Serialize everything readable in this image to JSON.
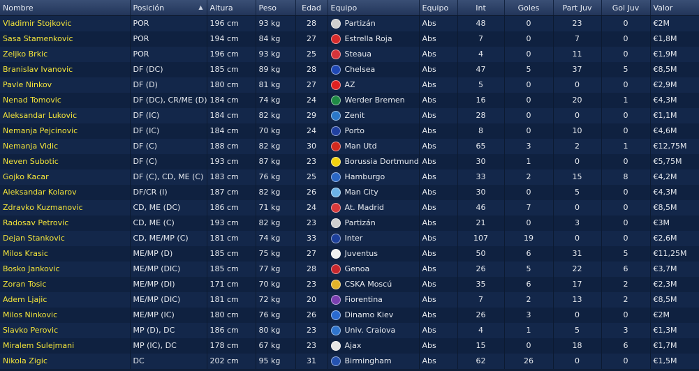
{
  "columns": {
    "nombre": "Nombre",
    "posicion": "Posición",
    "altura": "Altura",
    "peso": "Peso",
    "edad": "Edad",
    "equipo": "Equipo",
    "equipo2": "Equipo",
    "int": "Int",
    "goles": "Goles",
    "partjuv": "Part Juv",
    "goljuv": "Gol Juv",
    "valor": "Valor"
  },
  "sort_indicator": "▲",
  "players": [
    {
      "name": "Vladimir Stojkovic",
      "pos": "POR",
      "height": "196 cm",
      "weight": "93 kg",
      "age": "28",
      "club": "Partizán",
      "crest_color": "#cfcfcf",
      "squad": "Abs",
      "caps": "48",
      "goals": "0",
      "yth_apps": "23",
      "yth_goals": "0",
      "value": "€2M"
    },
    {
      "name": "Sasa Stamenkovic",
      "pos": "POR",
      "height": "194 cm",
      "weight": "84 kg",
      "age": "27",
      "club": "Estrella Roja",
      "crest_color": "#d62b2b",
      "squad": "Abs",
      "caps": "7",
      "goals": "0",
      "yth_apps": "7",
      "yth_goals": "0",
      "value": "€1,8M"
    },
    {
      "name": "Zeljko Brkic",
      "pos": "POR",
      "height": "196 cm",
      "weight": "93 kg",
      "age": "25",
      "club": "Steaua",
      "crest_color": "#d6343a",
      "squad": "Abs",
      "caps": "4",
      "goals": "0",
      "yth_apps": "11",
      "yth_goals": "0",
      "value": "€1,9M"
    },
    {
      "name": "Branislav Ivanovic",
      "pos": "DF (DC)",
      "height": "185 cm",
      "weight": "89 kg",
      "age": "28",
      "club": "Chelsea",
      "crest_color": "#1f48b5",
      "squad": "Abs",
      "caps": "47",
      "goals": "5",
      "yth_apps": "37",
      "yth_goals": "5",
      "value": "€8,5M"
    },
    {
      "name": "Pavle Ninkov",
      "pos": "DF (D)",
      "height": "180 cm",
      "weight": "81 kg",
      "age": "27",
      "club": "AZ",
      "crest_color": "#e02020",
      "squad": "Abs",
      "caps": "5",
      "goals": "0",
      "yth_apps": "0",
      "yth_goals": "0",
      "value": "€2,9M"
    },
    {
      "name": "Nenad Tomovic",
      "pos": "DF (DC), CR/ME (D)",
      "height": "184 cm",
      "weight": "74 kg",
      "age": "24",
      "club": "Werder Bremen",
      "crest_color": "#1f8a45",
      "squad": "Abs",
      "caps": "16",
      "goals": "0",
      "yth_apps": "20",
      "yth_goals": "1",
      "value": "€4,3M"
    },
    {
      "name": "Aleksandar Lukovic",
      "pos": "DF (IC)",
      "height": "184 cm",
      "weight": "82 kg",
      "age": "29",
      "club": "Zenit",
      "crest_color": "#2b78c9",
      "squad": "Abs",
      "caps": "28",
      "goals": "0",
      "yth_apps": "0",
      "yth_goals": "0",
      "value": "€1,1M"
    },
    {
      "name": "Nemanja Pejcinovic",
      "pos": "DF (IC)",
      "height": "184 cm",
      "weight": "70 kg",
      "age": "24",
      "club": "Porto",
      "crest_color": "#2040a0",
      "squad": "Abs",
      "caps": "8",
      "goals": "0",
      "yth_apps": "10",
      "yth_goals": "0",
      "value": "€4,6M"
    },
    {
      "name": "Nemanja Vidic",
      "pos": "DF (C)",
      "height": "188 cm",
      "weight": "82 kg",
      "age": "30",
      "club": "Man Utd",
      "crest_color": "#d42a1f",
      "squad": "Abs",
      "caps": "65",
      "goals": "3",
      "yth_apps": "2",
      "yth_goals": "1",
      "value": "€12,75M"
    },
    {
      "name": "Neven Subotic",
      "pos": "DF (C)",
      "height": "193 cm",
      "weight": "87 kg",
      "age": "23",
      "club": "Borussia Dortmund",
      "crest_color": "#f2d20f",
      "squad": "Abs",
      "caps": "30",
      "goals": "1",
      "yth_apps": "0",
      "yth_goals": "0",
      "value": "€5,75M"
    },
    {
      "name": "Gojko Kacar",
      "pos": "DF (C), CD, ME (C)",
      "height": "183 cm",
      "weight": "76 kg",
      "age": "25",
      "club": "Hamburgo",
      "crest_color": "#2b67c4",
      "squad": "Abs",
      "caps": "33",
      "goals": "2",
      "yth_apps": "15",
      "yth_goals": "8",
      "value": "€4,2M"
    },
    {
      "name": "Aleksandar Kolarov",
      "pos": "DF/CR (I)",
      "height": "187 cm",
      "weight": "82 kg",
      "age": "26",
      "club": "Man City",
      "crest_color": "#6cb2e6",
      "squad": "Abs",
      "caps": "30",
      "goals": "0",
      "yth_apps": "5",
      "yth_goals": "0",
      "value": "€4,3M"
    },
    {
      "name": "Zdravko Kuzmanovic",
      "pos": "CD, ME (DC)",
      "height": "186 cm",
      "weight": "71 kg",
      "age": "24",
      "club": "At. Madrid",
      "crest_color": "#d8393b",
      "squad": "Abs",
      "caps": "46",
      "goals": "7",
      "yth_apps": "0",
      "yth_goals": "0",
      "value": "€8,5M"
    },
    {
      "name": "Radosav Petrovic",
      "pos": "CD, ME (C)",
      "height": "193 cm",
      "weight": "82 kg",
      "age": "23",
      "club": "Partizán",
      "crest_color": "#cfcfcf",
      "squad": "Abs",
      "caps": "21",
      "goals": "0",
      "yth_apps": "3",
      "yth_goals": "0",
      "value": "€3M"
    },
    {
      "name": "Dejan Stankovic",
      "pos": "CD, ME/MP (C)",
      "height": "181 cm",
      "weight": "74 kg",
      "age": "33",
      "club": "Inter",
      "crest_color": "#1c3f9a",
      "squad": "Abs",
      "caps": "107",
      "goals": "19",
      "yth_apps": "0",
      "yth_goals": "0",
      "value": "€2,6M"
    },
    {
      "name": "Milos Krasic",
      "pos": "ME/MP (D)",
      "height": "185 cm",
      "weight": "75 kg",
      "age": "27",
      "club": "Juventus",
      "crest_color": "#f0f0f0",
      "squad": "Abs",
      "caps": "50",
      "goals": "6",
      "yth_apps": "31",
      "yth_goals": "5",
      "value": "€11,25M"
    },
    {
      "name": "Bosko Jankovic",
      "pos": "ME/MP (DIC)",
      "height": "185 cm",
      "weight": "77 kg",
      "age": "28",
      "club": "Genoa",
      "crest_color": "#c7272d",
      "squad": "Abs",
      "caps": "26",
      "goals": "5",
      "yth_apps": "22",
      "yth_goals": "6",
      "value": "€3,7M"
    },
    {
      "name": "Zoran Tosic",
      "pos": "ME/MP (DI)",
      "height": "171 cm",
      "weight": "70 kg",
      "age": "23",
      "club": "CSKA Moscú",
      "crest_color": "#e2b32a",
      "squad": "Abs",
      "caps": "35",
      "goals": "6",
      "yth_apps": "17",
      "yth_goals": "2",
      "value": "€2,3M"
    },
    {
      "name": "Adem Ljajic",
      "pos": "ME/MP (DIC)",
      "height": "181 cm",
      "weight": "72 kg",
      "age": "20",
      "club": "Fiorentina",
      "crest_color": "#7a3fb0",
      "squad": "Abs",
      "caps": "7",
      "goals": "2",
      "yth_apps": "13",
      "yth_goals": "2",
      "value": "€8,5M"
    },
    {
      "name": "Milos Ninkovic",
      "pos": "ME/MP (IC)",
      "height": "180 cm",
      "weight": "76 kg",
      "age": "26",
      "club": "Dinamo Kiev",
      "crest_color": "#2a6ad0",
      "squad": "Abs",
      "caps": "26",
      "goals": "3",
      "yth_apps": "0",
      "yth_goals": "0",
      "value": "€2M"
    },
    {
      "name": "Slavko Perovic",
      "pos": "MP (D), DC",
      "height": "186 cm",
      "weight": "80 kg",
      "age": "23",
      "club": "Univ. Craiova",
      "crest_color": "#2f74cc",
      "squad": "Abs",
      "caps": "4",
      "goals": "1",
      "yth_apps": "5",
      "yth_goals": "3",
      "value": "€1,3M"
    },
    {
      "name": "Miralem Sulejmani",
      "pos": "MP (IC), DC",
      "height": "178 cm",
      "weight": "67 kg",
      "age": "23",
      "club": "Ajax",
      "crest_color": "#e6e6e6",
      "squad": "Abs",
      "caps": "15",
      "goals": "0",
      "yth_apps": "18",
      "yth_goals": "6",
      "value": "€1,7M"
    },
    {
      "name": "Nikola Zigic",
      "pos": "DC",
      "height": "202 cm",
      "weight": "95 kg",
      "age": "31",
      "club": "Birmingham",
      "crest_color": "#2452b0",
      "squad": "Abs",
      "caps": "62",
      "goals": "26",
      "yth_apps": "0",
      "yth_goals": "0",
      "value": "€1,5M"
    }
  ]
}
